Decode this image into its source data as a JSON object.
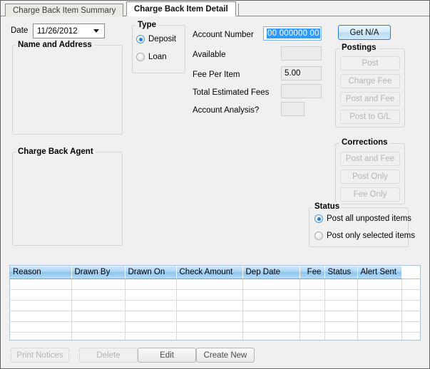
{
  "window": {
    "background": "#f0f0f0",
    "border_color": "#646464"
  },
  "tabs": [
    {
      "label": "Charge Back Item Summary",
      "active": false
    },
    {
      "label": "Charge Back Item Detail",
      "active": true
    }
  ],
  "left_panel": {
    "date_label": "Date",
    "date_value": "11/26/2012",
    "name_address_group": "Name and Address",
    "name_address_value": "",
    "charge_back_agent_group": "Charge Back Agent",
    "charge_back_agent_value": ""
  },
  "type_group": {
    "title": "Type",
    "options": [
      {
        "label": "Deposit",
        "selected": true
      },
      {
        "label": "Loan",
        "selected": false
      }
    ]
  },
  "account_fields": {
    "account_number_label": "Account Number",
    "account_number_value": "00 000000 00",
    "account_number_selected": true,
    "available_label": "Available",
    "available_value": "",
    "fee_per_item_label": "Fee Per Item",
    "fee_per_item_value": "5.00",
    "total_estimated_fees_label": "Total Estimated Fees",
    "total_estimated_fees_value": "",
    "account_analysis_label": "Account Analysis?",
    "account_analysis_value": ""
  },
  "get_na_button": {
    "label": "Get N/A",
    "enabled": true,
    "default": true
  },
  "postings_group": {
    "title": "Postings",
    "buttons": [
      {
        "label": "Post",
        "enabled": false
      },
      {
        "label": "Charge Fee",
        "enabled": false
      },
      {
        "label": "Post and Fee",
        "enabled": false
      },
      {
        "label": "Post to G/L",
        "enabled": false
      }
    ]
  },
  "corrections_group": {
    "title": "Corrections",
    "buttons": [
      {
        "label": "Post and Fee",
        "enabled": false
      },
      {
        "label": "Post Only",
        "enabled": false
      },
      {
        "label": "Fee Only",
        "enabled": false
      }
    ]
  },
  "status_group": {
    "title": "Status",
    "options": [
      {
        "label": "Post all unposted items",
        "selected": true
      },
      {
        "label": "Post only selected items",
        "selected": false
      }
    ]
  },
  "grid": {
    "columns": [
      {
        "label": "Reason",
        "align": "left"
      },
      {
        "label": "Drawn By",
        "align": "left"
      },
      {
        "label": "Drawn On",
        "align": "left"
      },
      {
        "label": "Check Amount",
        "align": "left"
      },
      {
        "label": "Dep Date",
        "align": "left"
      },
      {
        "label": "Fee",
        "align": "right"
      },
      {
        "label": "Status",
        "align": "left"
      },
      {
        "label": "Alert Sent",
        "align": "left"
      },
      {
        "label": "",
        "align": "left"
      }
    ],
    "rows": [],
    "empty_row_count": 6
  },
  "bottom_buttons": [
    {
      "label": "Print Notices",
      "enabled": false
    },
    {
      "label": "Delete",
      "enabled": false
    },
    {
      "label": "Edit",
      "enabled": true
    },
    {
      "label": "Create New",
      "enabled": true
    }
  ],
  "colors": {
    "accent_blue": "#3399ff",
    "header_blue": "#8bc4ef",
    "default_button_border": "#2c7fd0"
  }
}
